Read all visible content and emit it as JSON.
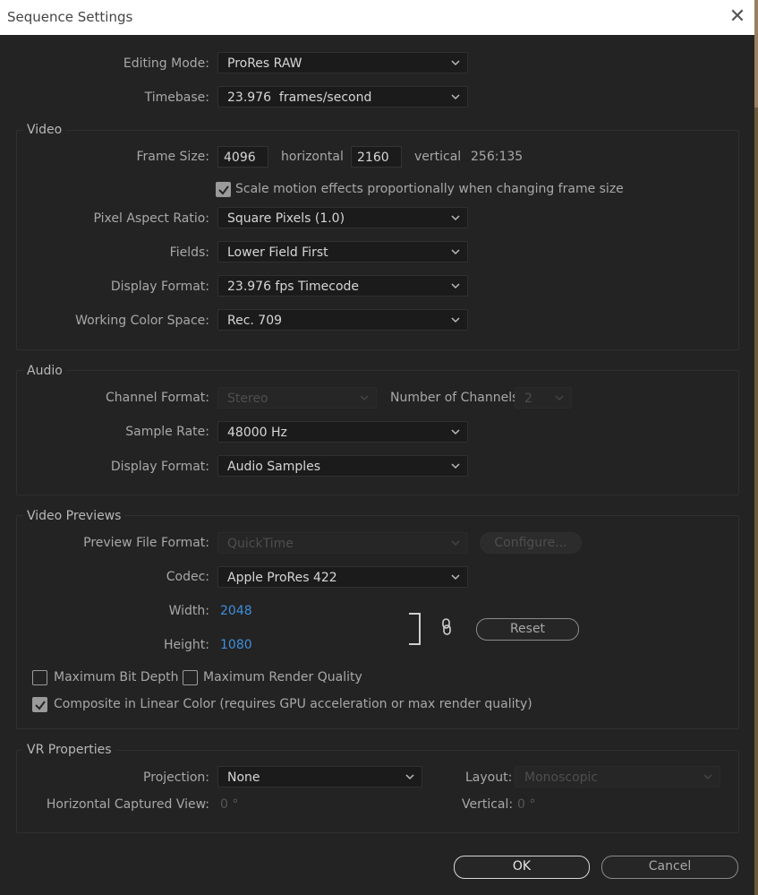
{
  "window": {
    "title": "Sequence Settings",
    "close_glyph": "✕"
  },
  "general": {
    "editing_mode": {
      "label": "Editing Mode:",
      "value": "ProRes RAW"
    },
    "timebase": {
      "label": "Timebase:",
      "value": "23.976  frames/second"
    }
  },
  "video": {
    "section": "Video",
    "frame_size": {
      "label": "Frame Size:",
      "width": "4096",
      "horizontal": "horizontal",
      "height": "2160",
      "vertical": "vertical",
      "ratio": "256:135"
    },
    "scale_motion": {
      "label": "Scale motion effects proportionally when changing frame size",
      "checked": true
    },
    "pixel_aspect": {
      "label": "Pixel Aspect Ratio:",
      "value": "Square Pixels (1.0)"
    },
    "fields": {
      "label": "Fields:",
      "value": "Lower Field First"
    },
    "display_format": {
      "label": "Display Format:",
      "value": "23.976 fps Timecode"
    },
    "color_space": {
      "label": "Working Color Space:",
      "value": "Rec. 709"
    }
  },
  "audio": {
    "section": "Audio",
    "channel_format": {
      "label": "Channel Format:",
      "value": "Stereo"
    },
    "num_channels": {
      "label": "Number of Channels:",
      "value": "2"
    },
    "sample_rate": {
      "label": "Sample Rate:",
      "value": "48000 Hz"
    },
    "display_format": {
      "label": "Display Format:",
      "value": "Audio Samples"
    }
  },
  "previews": {
    "section": "Video Previews",
    "file_format": {
      "label": "Preview File Format:",
      "value": "QuickTime"
    },
    "configure": "Configure...",
    "codec": {
      "label": "Codec:",
      "value": "Apple ProRes 422"
    },
    "width": {
      "label": "Width:",
      "value": "2048"
    },
    "height": {
      "label": "Height:",
      "value": "1080"
    },
    "reset": "Reset",
    "max_bit_depth": {
      "label": "Maximum Bit Depth",
      "checked": false
    },
    "max_render_quality": {
      "label": "Maximum Render Quality",
      "checked": false
    },
    "linear_color": {
      "label": "Composite in Linear Color (requires GPU acceleration or max render quality)",
      "checked": true
    }
  },
  "vr": {
    "section": "VR Properties",
    "projection": {
      "label": "Projection:",
      "value": "None"
    },
    "layout": {
      "label": "Layout:",
      "value": "Monoscopic"
    },
    "h_view": {
      "label": "Horizontal Captured View:",
      "value": "0 °"
    },
    "vertical": {
      "label": "Vertical:",
      "value": "0 °"
    }
  },
  "footer": {
    "ok": "OK",
    "cancel": "Cancel"
  },
  "icons": {
    "chevron": "chevron-down-icon",
    "link": "link-icon",
    "check": "checkmark-icon",
    "close": "close-icon"
  }
}
